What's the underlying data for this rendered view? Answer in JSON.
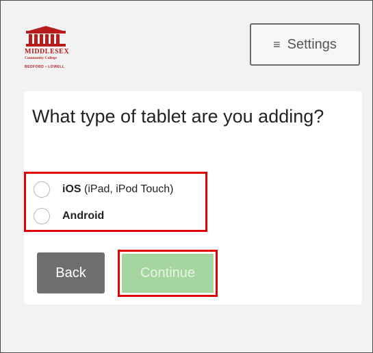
{
  "logo": {
    "name": "MIDDLESEX",
    "subtitle": "Community College",
    "locations": "BEDFORD • LOWELL"
  },
  "header": {
    "settings_icon": "hamburger-menu-icon",
    "settings_label": "Settings",
    "settings_glyph": "≡"
  },
  "main": {
    "question": "What type of tablet are you adding?",
    "options": [
      {
        "bold": "iOS",
        "rest": " (iPad, iPod Touch)",
        "selected": false
      },
      {
        "bold": "Android",
        "rest": "",
        "selected": false
      }
    ],
    "back_label": "Back",
    "continue_label": "Continue"
  },
  "colors": {
    "brand_red": "#b71c1c",
    "highlight_red": "#e00000",
    "back_gray": "#6f6f6f",
    "continue_disabled_green": "#a5d6a0"
  }
}
